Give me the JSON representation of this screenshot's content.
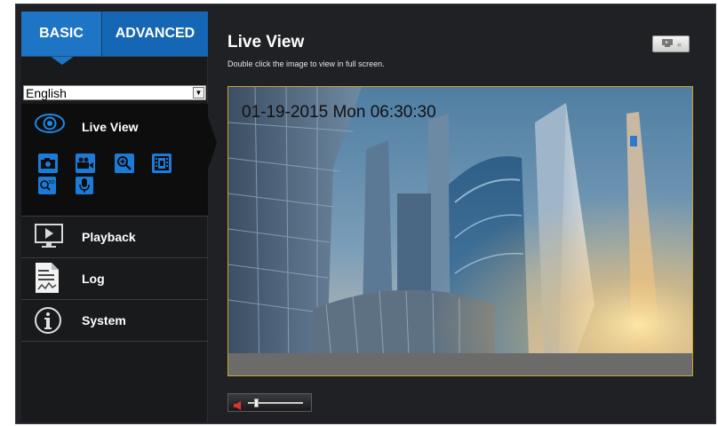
{
  "tabs": {
    "basic": "BASIC",
    "advanced": "ADVANCED"
  },
  "language": {
    "selected": "English"
  },
  "menu": {
    "live_view": "Live View",
    "playback": "Playback",
    "log": "Log",
    "system": "System"
  },
  "live_view_tools": [
    "snapshot-icon",
    "record-icon",
    "digital-zoom-icon",
    "video-setting-icon",
    "3d-zoom-icon",
    "microphone-icon"
  ],
  "main": {
    "title": "Live View",
    "subtitle": "Double click the image to view in full screen.",
    "timestamp": "01-19-2015  Mon 06:30:30"
  },
  "audio": {
    "volume": 0.12
  },
  "colors": {
    "accent_blue": "#1e74c5",
    "video_border": "#caa32b",
    "panel_bg": "#191a1c"
  }
}
